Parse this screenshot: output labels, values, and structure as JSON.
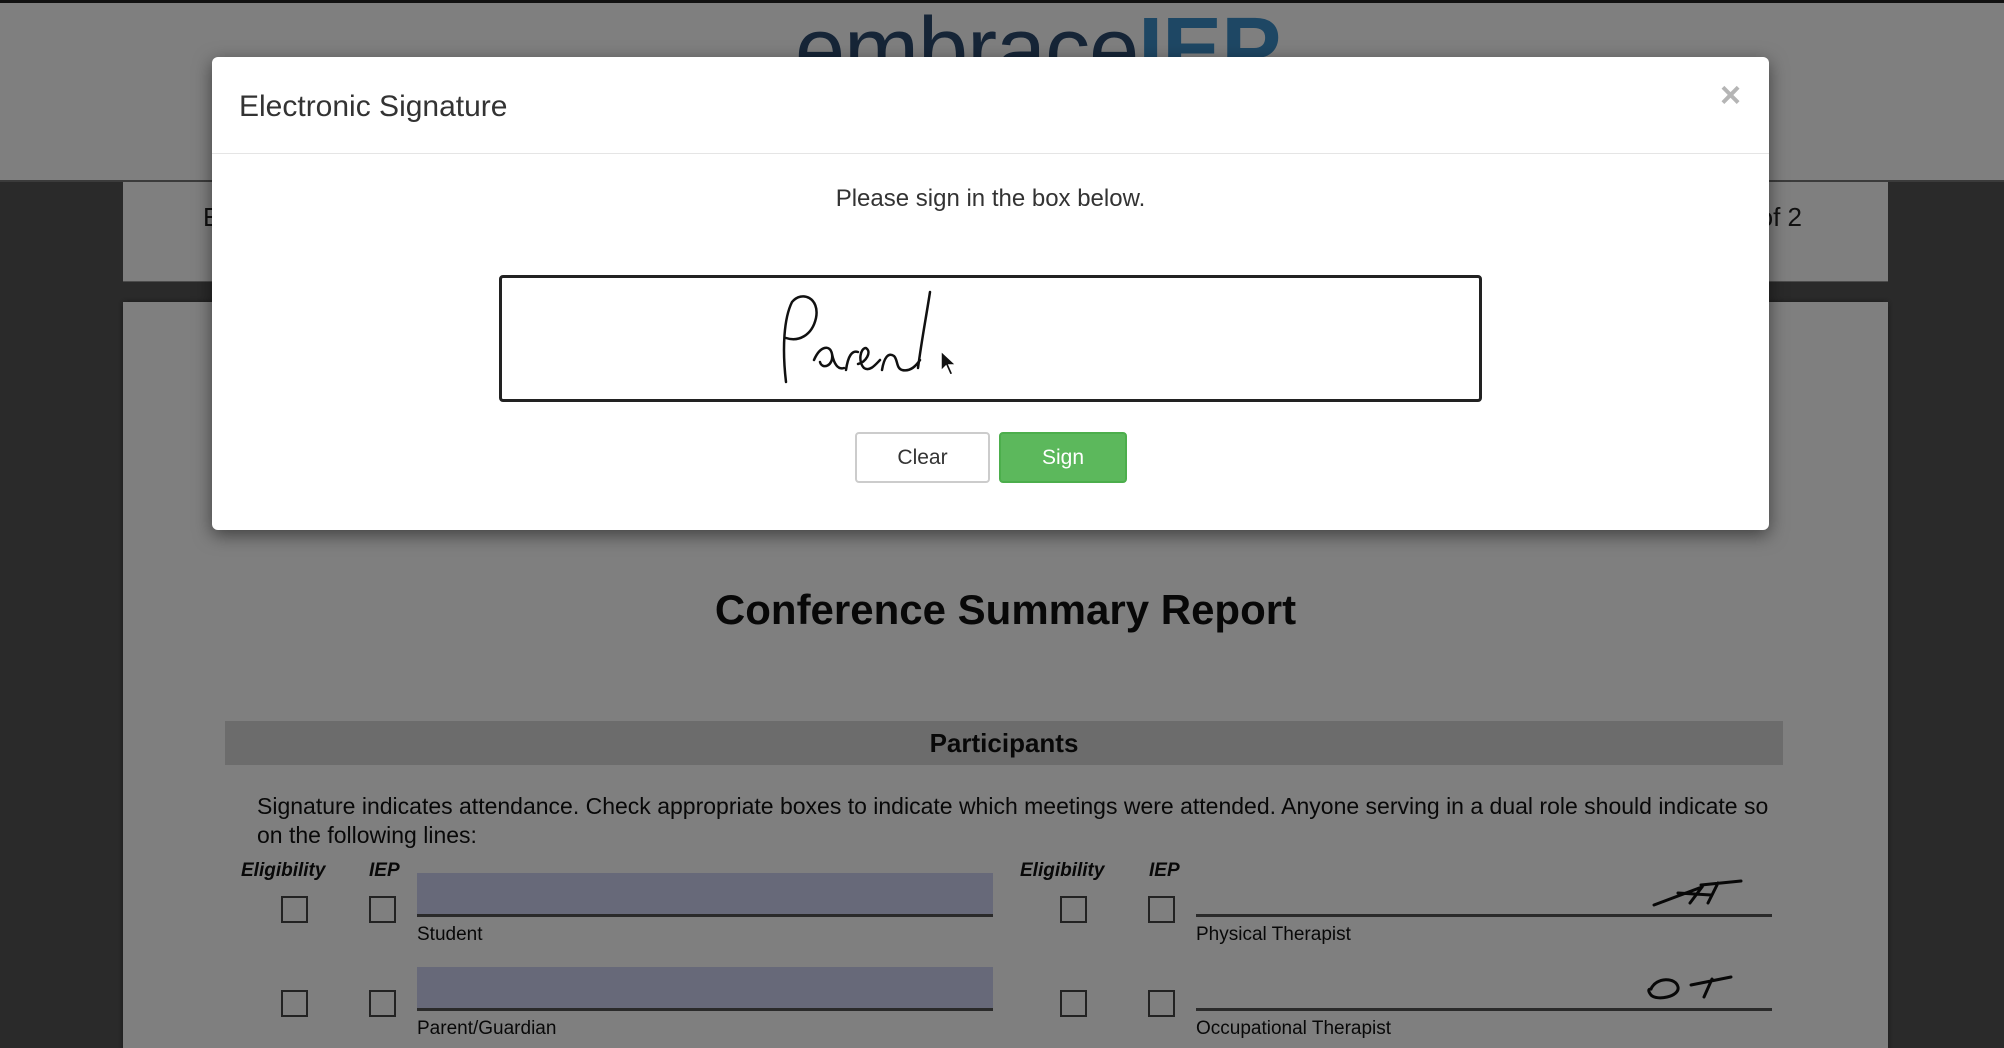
{
  "app": {
    "logo_part1": "embrace",
    "logo_part2": "IEP"
  },
  "page_strip": {
    "left_text": "E",
    "right_text": "of 2"
  },
  "document": {
    "title": "Conference Summary Report",
    "section_title": "Participants",
    "instructions": "Signature indicates attendance. Check appropriate boxes to indicate which meetings were attended. Anyone serving in a dual role should indicate so on the following lines:",
    "column_headers": {
      "eligibility": "Eligibility",
      "iep": "IEP"
    },
    "participants": [
      {
        "role": "Student",
        "signed": false
      },
      {
        "role": "Parent/Guardian",
        "signed": false
      },
      {
        "role": "Physical Therapist",
        "signed": true,
        "signature_text": "PT"
      },
      {
        "role": "Occupational Therapist",
        "signed": true,
        "signature_text": "OT"
      }
    ]
  },
  "modal": {
    "title": "Electronic Signature",
    "close_symbol": "×",
    "prompt": "Please sign in the box below.",
    "signature_text": "Parent",
    "buttons": {
      "clear": "Clear",
      "sign": "Sign"
    }
  },
  "colors": {
    "sign_button": "#5cb85c",
    "fill_line": "#cfd2f3",
    "logo_dark": "#2c4a6e",
    "logo_accent": "#3c8fc9"
  }
}
